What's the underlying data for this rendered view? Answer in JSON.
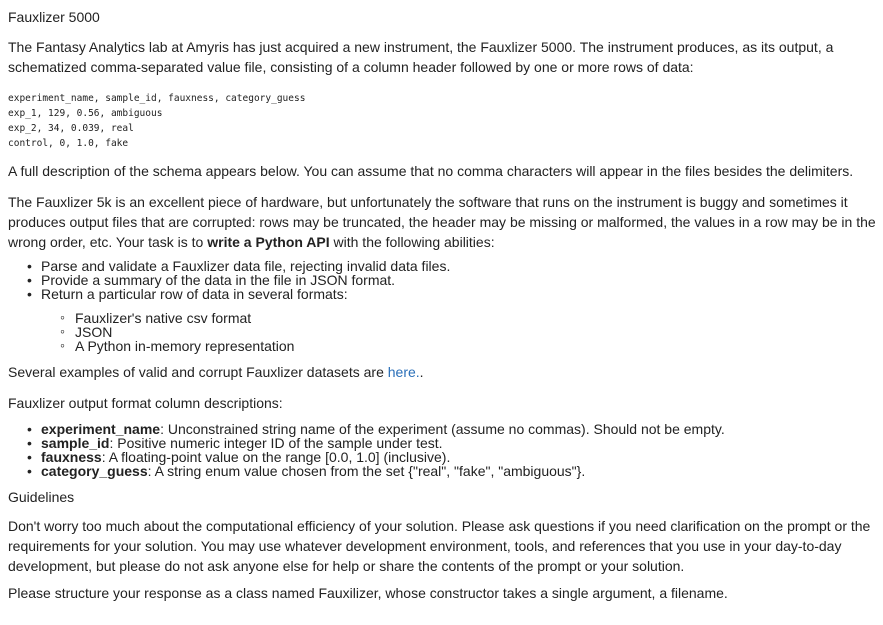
{
  "title": "Fauxlizer 5000",
  "intro": "The Fantasy Analytics lab at Amyris has just acquired a new instrument, the Fauxlizer 5000. The instrument produces, as its output, a schematized comma-separated value file, consisting of a column header followed by one or more rows of data:",
  "code_lines": [
    "experiment_name, sample_id, fauxness, category_guess",
    "exp_1, 129, 0.56, ambiguous",
    "exp_2, 34, 0.039, real",
    "control, 0, 1.0, fake"
  ],
  "schema_note": "A full description of the schema appears below. You can assume that no comma characters will appear in the files besides the delimiters.",
  "task_para_before": "The Fauxlizer 5k is an excellent piece of hardware, but unfortunately the software that runs on the instrument is buggy and sometimes it produces output files that are corrupted: rows may be truncated, the header may be missing or malformed, the values in a row may be in the wrong order, etc. Your task is to ",
  "task_para_bold": "write a Python API",
  "task_para_after": " with the following abilities:",
  "abilities": [
    "Parse and validate a Fauxlizer data file, rejecting invalid data files.",
    "Provide a summary of the data in the file in JSON format.",
    "Return a particular row of data in several formats:"
  ],
  "formats": [
    "Fauxlizer's native csv format",
    "JSON",
    "A Python in-memory representation"
  ],
  "examples_text": "Several examples of valid and corrupt Fauxlizer datasets are ",
  "examples_link": "here.",
  "examples_tail": ".",
  "columns_heading": "Fauxlizer output format column descriptions:",
  "columns": [
    {
      "name": "experiment_name",
      "desc": ": Unconstrained string name of the experiment (assume no commas). Should not be empty."
    },
    {
      "name": "sample_id",
      "desc": ": Positive numeric integer ID of the sample under test."
    },
    {
      "name": "fauxness",
      "desc": ": A floating-point value on the range [0.0, 1.0] (inclusive)."
    },
    {
      "name": "category_guess",
      "desc": ": A string enum value chosen from the set {\"real\", \"fake\", \"ambiguous\"}."
    }
  ],
  "guidelines_heading": "Guidelines",
  "guidelines": "Don't worry too much about the computational efficiency of your solution. Please ask questions if you need clarification on the prompt or the requirements for your solution. You may use whatever development environment, tools, and references that you use in your day-to-day development, but please do not ask anyone else for help or share the contents of the prompt or your solution.",
  "closing": "Please structure your response as a class named Fauxilizer, whose constructor takes a single argument, a filename."
}
